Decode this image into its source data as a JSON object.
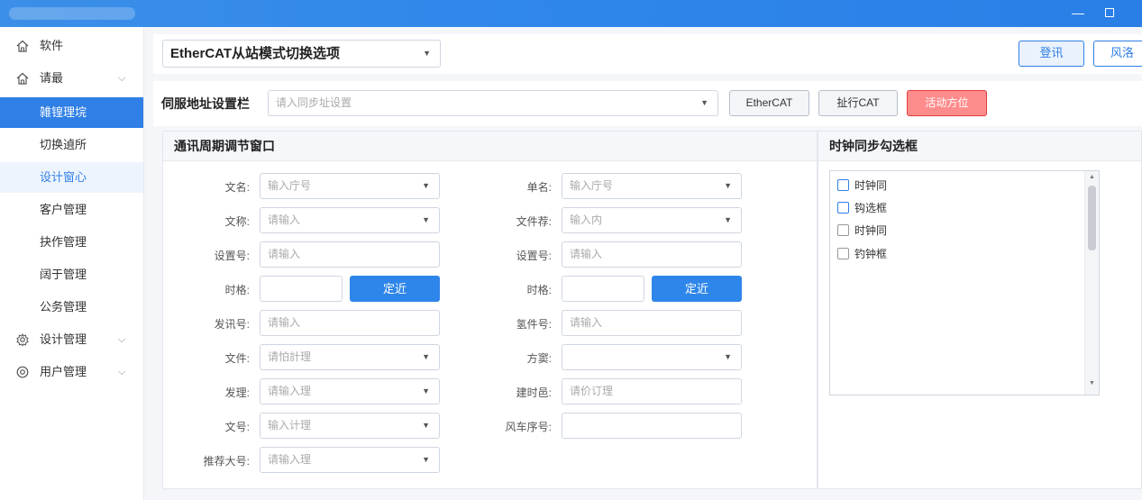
{
  "window": {
    "min_icon": "minimize-icon",
    "max_icon": "maximize-icon"
  },
  "sidebar": {
    "items": [
      {
        "label": "软件",
        "icon": "home-icon"
      },
      {
        "label": "请最",
        "icon": "home-icon",
        "chevron": "⌵"
      },
      {
        "label": "雑锽理垸"
      },
      {
        "label": "切换遉所"
      },
      {
        "label": "设计窗心"
      },
      {
        "label": "客户管理"
      },
      {
        "label": "抉作管理"
      },
      {
        "label": "阔于管理"
      },
      {
        "label": "公务管理"
      },
      {
        "label": "设计管理",
        "icon": "gear-icon",
        "chevron": "⌵"
      },
      {
        "label": "用户管理",
        "icon": "user-settings-icon",
        "chevron": "⌵"
      }
    ],
    "active_index": 2,
    "highlight_index": 4
  },
  "topbar": {
    "mode_select": "EtherCAT从站模式切换选项",
    "login_button": "登讯",
    "style_button": "风洛"
  },
  "address": {
    "label": "伺服地址设置栏",
    "placeholder": "请入同步址设置",
    "btn_ethercat": "EtherCAT",
    "btn_run": "扯行CAT",
    "btn_active": "活动方位"
  },
  "comm_panel": {
    "title": "通讯周期调节窗口",
    "left_fields": [
      {
        "label": "文名:",
        "placeholder": "输入庁号",
        "type": "select"
      },
      {
        "label": "文称:",
        "placeholder": "请输入",
        "type": "select"
      },
      {
        "label": "设置号:",
        "placeholder": "请输入",
        "type": "input"
      },
      {
        "label": "时格:",
        "placeholder": "",
        "type": "input-button",
        "button": "定近"
      },
      {
        "label": "发讯号:",
        "placeholder": "请输入",
        "type": "input"
      },
      {
        "label": "文件:",
        "placeholder": "请怕計理",
        "type": "select"
      },
      {
        "label": "发理:",
        "placeholder": "请输入理",
        "type": "select"
      },
      {
        "label": "文号:",
        "placeholder": "输入计理",
        "type": "select"
      },
      {
        "label": "推荐大号:",
        "placeholder": "请输入理",
        "type": "select"
      }
    ],
    "right_fields": [
      {
        "label": "单名:",
        "placeholder": "输入庁号",
        "type": "select"
      },
      {
        "label": "文件荐:",
        "placeholder": "输入内",
        "type": "select"
      },
      {
        "label": "设置号:",
        "placeholder": "请输入",
        "type": "input"
      },
      {
        "label": "时格:",
        "placeholder": "",
        "type": "input-button",
        "button": "定近"
      },
      {
        "label": "氢件号:",
        "placeholder": "请输入",
        "type": "input"
      },
      {
        "label": "方窦:",
        "placeholder": "",
        "type": "select"
      },
      {
        "label": "建时邑:",
        "placeholder": "请价订理",
        "type": "input"
      },
      {
        "label": "风车序号:",
        "placeholder": "",
        "type": "input"
      }
    ]
  },
  "sync_panel": {
    "title": "时钟同步勾选框",
    "items": [
      {
        "label": "时钟同",
        "checked": false,
        "accent": true
      },
      {
        "label": "钩选框",
        "checked": false,
        "accent": true
      },
      {
        "label": "时钟同",
        "checked": false,
        "accent": false
      },
      {
        "label": "钓钟框",
        "checked": false,
        "accent": false
      }
    ]
  },
  "colors": {
    "primary": "#2f7fe6",
    "danger_bg": "#ff8c8c",
    "danger_border": "#e03b3b"
  }
}
